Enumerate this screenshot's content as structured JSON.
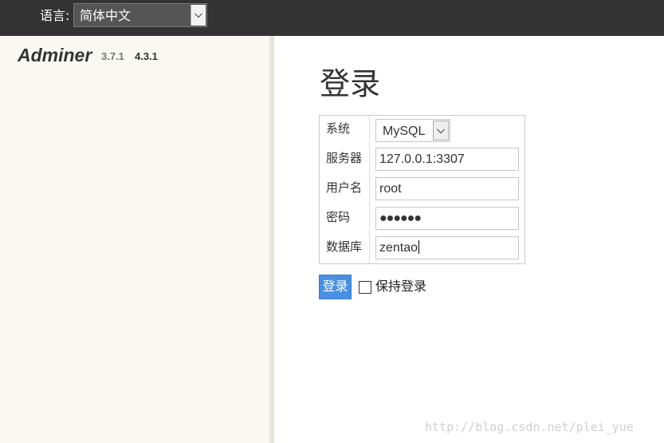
{
  "topbar": {
    "language_label": "语言:",
    "language_value": "简体中文"
  },
  "sidebar": {
    "app_name": "Adminer",
    "version_old": "3.7.1",
    "version_new": "4.3.1"
  },
  "login": {
    "title": "登录",
    "fields": {
      "system": {
        "label": "系统",
        "value": "MySQL"
      },
      "server": {
        "label": "服务器",
        "value": "127.0.0.1:3307"
      },
      "username": {
        "label": "用户名",
        "value": "root"
      },
      "password": {
        "label": "密码",
        "value": "●●●●●●"
      },
      "database": {
        "label": "数据库",
        "value": "zentao"
      }
    },
    "submit_label": "登录",
    "permanent_label": "保持登录"
  },
  "watermark": "http://blog.csdn.net/plei_yue",
  "colors": {
    "topbar_bg": "#333333",
    "sidebar_bg": "#f9f8f3",
    "button_accent": "#4a90e2"
  }
}
